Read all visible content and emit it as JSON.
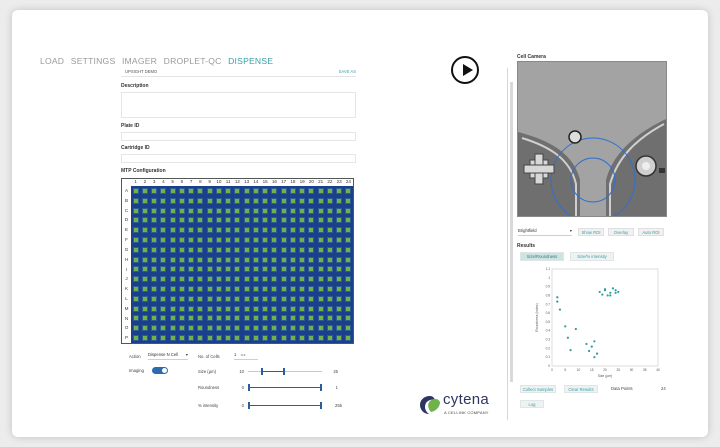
{
  "nav": [
    "LOAD",
    "SETTINGS",
    "IMAGER",
    "DROPLET-QC",
    "DISPENSE"
  ],
  "file": {
    "name": "UPSIGHT DEMO",
    "save": "SAVE AS"
  },
  "labels": {
    "description": "Description",
    "plate_id": "Plate ID",
    "cartridge_id": "Cartridge ID",
    "mtp": "MTP Configuration"
  },
  "plate": {
    "columns": [
      "1",
      "2",
      "3",
      "4",
      "5",
      "6",
      "7",
      "8",
      "9",
      "10",
      "11",
      "12",
      "13",
      "14",
      "15",
      "16",
      "17",
      "18",
      "19",
      "20",
      "21",
      "22",
      "23",
      "24"
    ],
    "rows": [
      "A",
      "B",
      "C",
      "D",
      "E",
      "F",
      "G",
      "H",
      "I",
      "J",
      "K",
      "L",
      "M",
      "N",
      "O",
      "P"
    ]
  },
  "controls": {
    "action_label": "Action",
    "action_value": "Dispense N Cell",
    "cells_label": "No. of Cells",
    "cells_value": "1",
    "imaging_label": "Imaging",
    "size_label": "Size (µm)",
    "size_min": "10",
    "size_max": "25",
    "round_label": "Roundness",
    "round_min": "0",
    "round_max": "1",
    "int_label": "% intensity",
    "int_min": "0",
    "int_max": "255"
  },
  "camera": {
    "title": "Cell Camera",
    "mode": "Brightfield",
    "btn1": "Show ROI",
    "btn2": "Overlay",
    "btn3": "Auto ROI"
  },
  "results": {
    "title": "Results",
    "tab1": "Size/Roundness",
    "tab2": "Size/% intensity",
    "collect": "Collect Samples",
    "clear": "Clear Results",
    "dp_label": "Data Points",
    "dp_value": "24",
    "log": "Log"
  },
  "brand": {
    "name": "cytena",
    "sub": "A CELLINK COMPANY",
    "color": "#2d3561",
    "accent": "#3ba0a8"
  },
  "chart_data": {
    "type": "scatter",
    "xlabel": "Size (µm)",
    "ylabel": "Roundness (index)",
    "xlim": [
      0,
      40
    ],
    "ylim": [
      0,
      1.1
    ],
    "xticks": [
      "0",
      "5",
      "10",
      "15",
      "20",
      "25",
      "30",
      "35",
      "40"
    ],
    "yticks": [
      "0",
      "0.1",
      "0.2",
      "0.3",
      "0.4",
      "0.5",
      "0.6",
      "0.7",
      "0.8",
      "0.9",
      "1",
      "1.1"
    ],
    "points": [
      [
        2,
        0.78
      ],
      [
        2,
        0.73
      ],
      [
        3,
        0.64
      ],
      [
        5,
        0.45
      ],
      [
        6,
        0.32
      ],
      [
        7,
        0.18
      ],
      [
        9,
        0.42
      ],
      [
        13,
        0.25
      ],
      [
        14,
        0.17
      ],
      [
        15,
        0.22
      ],
      [
        16,
        0.28
      ],
      [
        17,
        0.14
      ],
      [
        18,
        0.84
      ],
      [
        19,
        0.81
      ],
      [
        20,
        0.86
      ],
      [
        21,
        0.8
      ],
      [
        22,
        0.83
      ],
      [
        23,
        0.88
      ],
      [
        24,
        0.83
      ],
      [
        25,
        0.84
      ],
      [
        20,
        0.87
      ],
      [
        22,
        0.8
      ],
      [
        16,
        0.1
      ],
      [
        24,
        0.86
      ]
    ]
  }
}
